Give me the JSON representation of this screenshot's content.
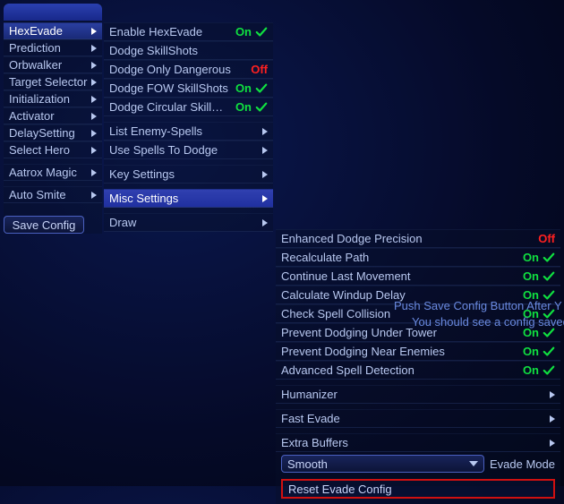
{
  "col1": {
    "items": [
      {
        "label": "HexEvade",
        "arrow": true,
        "active": true
      },
      {
        "label": "Prediction",
        "arrow": true
      },
      {
        "label": "Orbwalker",
        "arrow": true
      },
      {
        "label": "Target Selector",
        "arrow": true
      },
      {
        "label": "Initialization",
        "arrow": true
      },
      {
        "label": "Activator",
        "arrow": true
      },
      {
        "label": "DelaySetting",
        "arrow": true
      },
      {
        "label": "Select Hero",
        "arrow": true
      }
    ],
    "extra1": {
      "label": "Aatrox Magic",
      "arrow": true
    },
    "extra2": {
      "label": "Auto Smite",
      "arrow": true
    },
    "save_label": "Save Config"
  },
  "col2": {
    "items": [
      {
        "label": "Enable HexEvade",
        "state": "On",
        "check": true
      },
      {
        "label": "Dodge SkillShots"
      },
      {
        "label": "Dodge Only Dangerous",
        "state": "Off"
      },
      {
        "label": "Dodge FOW SkillShots",
        "state": "On",
        "check": true
      },
      {
        "label": "Dodge Circular SkillShots",
        "state": "On",
        "check": true
      }
    ],
    "items2": [
      {
        "label": "List Enemy-Spells",
        "arrow": true
      },
      {
        "label": "Use Spells To Dodge",
        "arrow": true
      }
    ],
    "items3": [
      {
        "label": "Key Settings",
        "arrow": true
      }
    ],
    "items4": [
      {
        "label": "Misc Settings",
        "arrow": true,
        "highlight": true
      }
    ],
    "items5": [
      {
        "label": "Draw",
        "arrow": true
      }
    ]
  },
  "col3": {
    "items": [
      {
        "label": "Enhanced Dodge Precision",
        "state": "Off"
      },
      {
        "label": "Recalculate Path",
        "state": "On",
        "check": true
      },
      {
        "label": "Continue Last Movement",
        "state": "On",
        "check": true
      },
      {
        "label": "Calculate Windup Delay",
        "state": "On",
        "check": true
      },
      {
        "label": "Check Spell Collision",
        "state": "On",
        "check": true
      },
      {
        "label": "Prevent Dodging Under Tower",
        "state": "On",
        "check": true
      },
      {
        "label": "Prevent Dodging Near Enemies",
        "state": "On",
        "check": true
      },
      {
        "label": "Advanced Spell Detection",
        "state": "On",
        "check": true
      }
    ],
    "items2": [
      {
        "label": "Humanizer",
        "arrow": true
      }
    ],
    "items3": [
      {
        "label": "Fast Evade",
        "arrow": true
      }
    ],
    "items4": [
      {
        "label": "Extra Buffers",
        "arrow": true
      }
    ],
    "dropdown": {
      "value": "Smooth",
      "label": "Evade Mode"
    },
    "reset_label": "Reset Evade Config"
  },
  "tooltip": {
    "line1": "Push Save Config Button After Y",
    "line2": "You should see a config saved s"
  }
}
